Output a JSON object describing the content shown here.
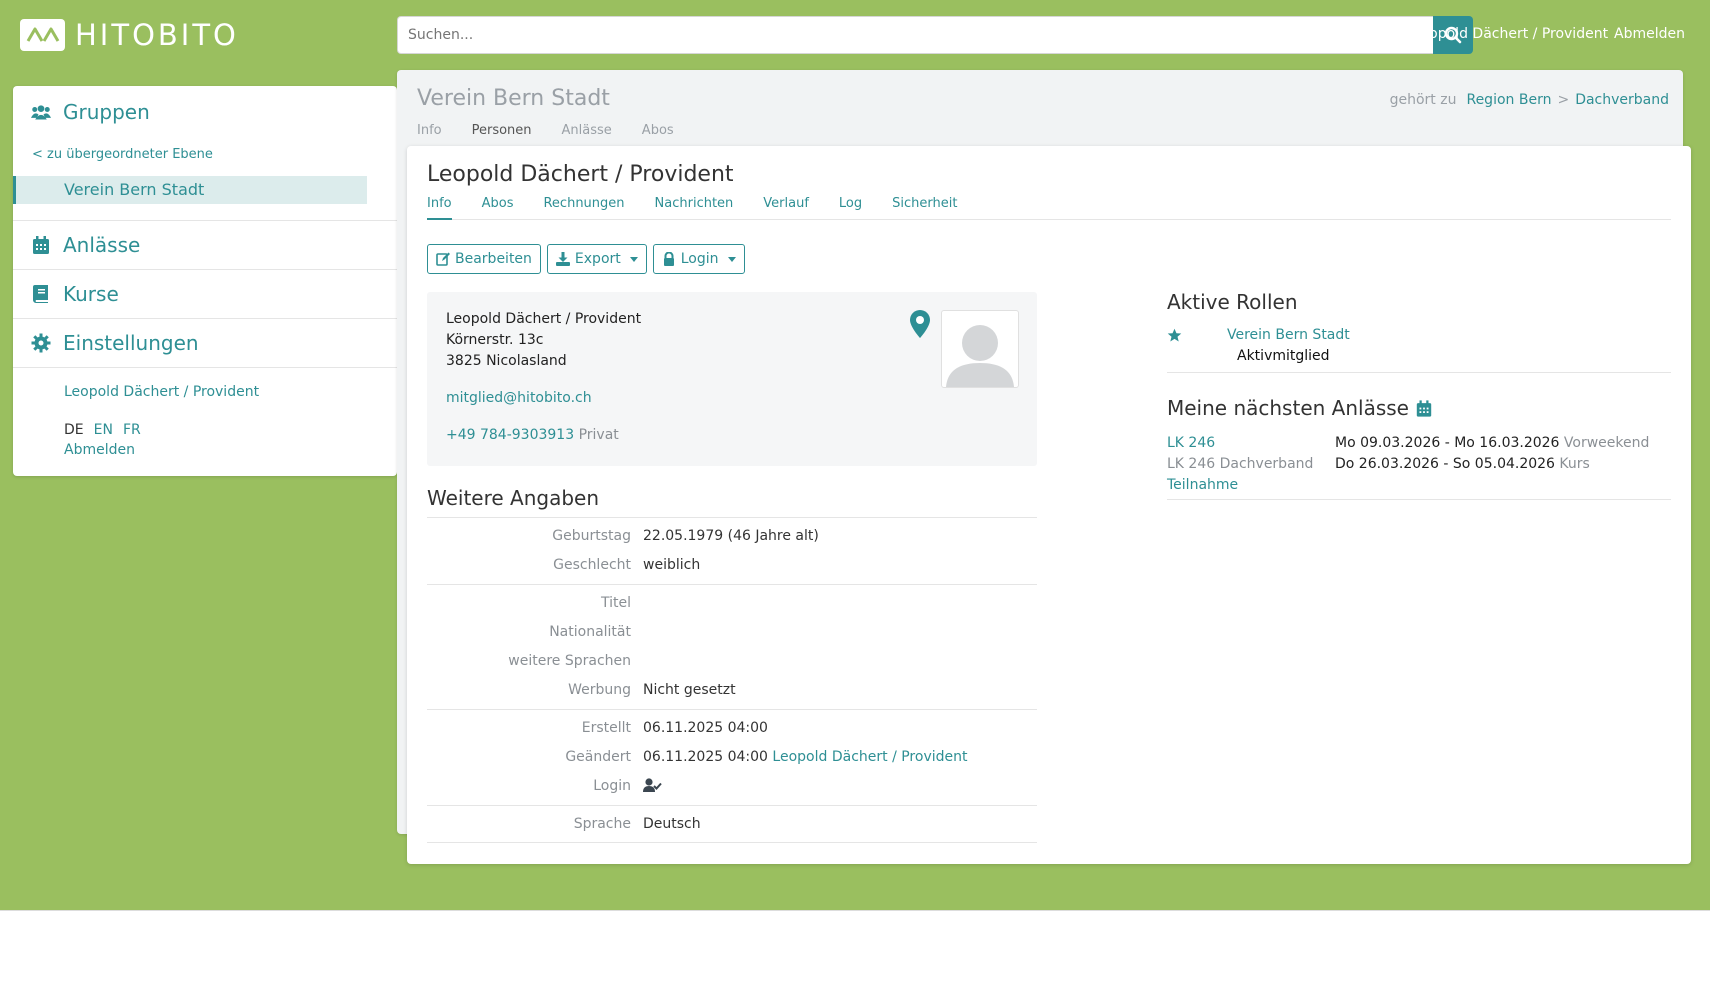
{
  "app": {
    "brand": "HITOBITO",
    "accent": "#2e8f94",
    "background": "#9abf5f"
  },
  "header": {
    "search_placeholder": "Suchen...",
    "user": "Leopold Dächert / Provident",
    "logout": "Abmelden"
  },
  "sidebar": {
    "groups_label": "Gruppen",
    "back_link": "< zu übergeordneter Ebene",
    "current_group": "Verein Bern Stadt",
    "events_label": "Anlässe",
    "courses_label": "Kurse",
    "settings_label": "Einstellungen",
    "user": "Leopold Dächert / Provident",
    "languages": [
      "DE",
      "EN",
      "FR"
    ],
    "current_language": "DE",
    "logout": "Abmelden"
  },
  "group": {
    "title": "Verein Bern Stadt",
    "tabs": [
      "Info",
      "Personen",
      "Anlässe",
      "Abos"
    ],
    "active_tab": "Personen",
    "belongs_label": "gehört zu",
    "parents": [
      "Region Bern",
      "Dachverband"
    ],
    "parent_separator": ">"
  },
  "person": {
    "name": "Leopold Dächert / Provident",
    "tabs": [
      "Info",
      "Abos",
      "Rechnungen",
      "Nachrichten",
      "Verlauf",
      "Log",
      "Sicherheit"
    ],
    "active_tab": "Info",
    "actions": {
      "edit": "Bearbeiten",
      "export": "Export",
      "login": "Login"
    },
    "contact": {
      "name": "Leopold Dächert / Provident",
      "street": "Körnerstr. 13c",
      "city": "3825 Nicolasland",
      "email": "mitglied@hitobito.ch",
      "phone": "+49 784-9303913",
      "phone_label": "Privat"
    },
    "further_title": "Weitere Angaben",
    "details": [
      {
        "label": "Geburtstag",
        "value": "22.05.1979 (46 Jahre alt)"
      },
      {
        "label": "Geschlecht",
        "value": "weiblich"
      },
      {
        "label": "Titel",
        "value": ""
      },
      {
        "label": "Nationalität",
        "value": ""
      },
      {
        "label": "weitere Sprachen",
        "value": ""
      },
      {
        "label": "Werbung",
        "value": "Nicht gesetzt"
      },
      {
        "label": "Erstellt",
        "value": "06.11.2025 04:00"
      },
      {
        "label": "Geändert",
        "value": "06.11.2025 04:00",
        "link": "Leopold Dächert / Provident"
      },
      {
        "label": "Login",
        "value": "",
        "icon": "user-check-icon"
      },
      {
        "label": "Sprache",
        "value": "Deutsch"
      }
    ],
    "roles_title": "Aktive Rollen",
    "roles": [
      {
        "group": "Verein Bern Stadt",
        "role": "Aktivmitglied"
      }
    ],
    "events_title": "Meine nächsten Anlässe",
    "events": [
      {
        "name": "LK 246",
        "subtitle": "",
        "dates": "Mo 09.03.2026 - Mo 16.03.2026",
        "kind": "Vorweekend"
      },
      {
        "name": "LK 246 Dachverband",
        "subtitle": "Teilnahme",
        "dates": "Do 26.03.2026 - So 05.04.2026",
        "kind": "Kurs"
      }
    ]
  }
}
